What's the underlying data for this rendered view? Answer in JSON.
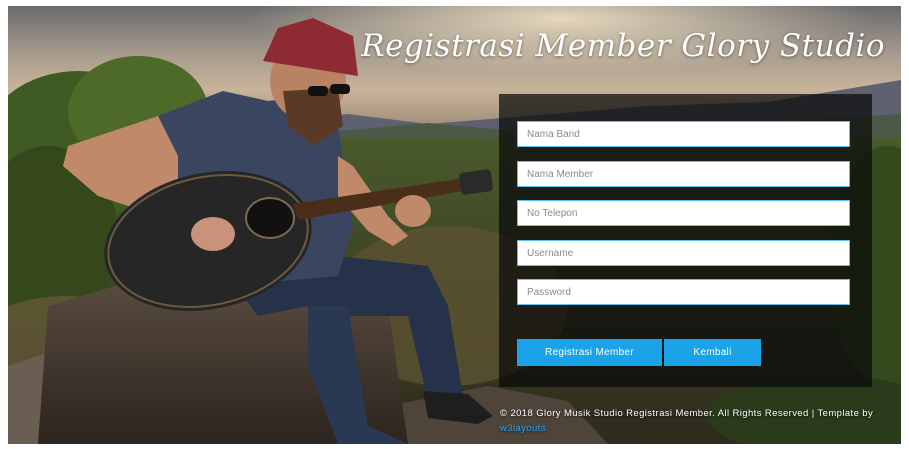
{
  "header": {
    "title": "Registrasi Member Glory Studio"
  },
  "form": {
    "fields": [
      {
        "placeholder": "Nama Band"
      },
      {
        "placeholder": "Nama Member"
      },
      {
        "placeholder": "No Telepon"
      },
      {
        "placeholder": "Username"
      },
      {
        "placeholder": "Password"
      }
    ],
    "submit_label": "Registrasi Member",
    "back_label": "Kembali"
  },
  "footer": {
    "copyright": "© 2018 Glory Musik Studio Registrasi Member. All Rights Reserved | Template by",
    "link_text": "w3layouts"
  },
  "colors": {
    "accent": "#1aa3e8",
    "field_border": "#5bc2ef",
    "link": "#2ea8ff"
  },
  "background": {
    "icon": "guitarist-on-rock-photo"
  }
}
